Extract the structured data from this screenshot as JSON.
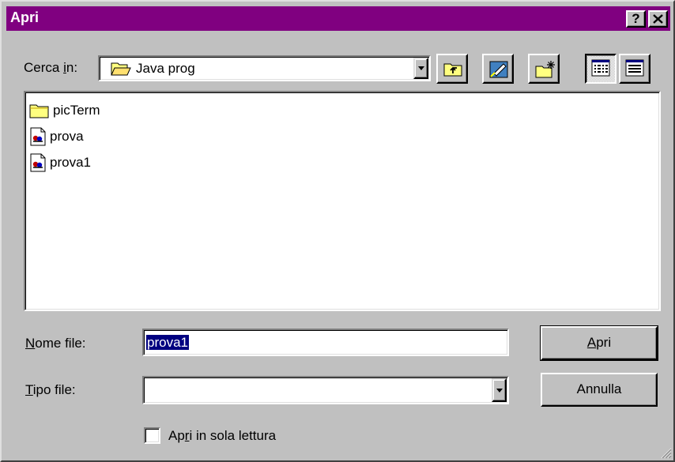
{
  "window": {
    "title": "Apri",
    "help_label": "?"
  },
  "look_in": {
    "label_prefix": "Cerca ",
    "label_hotkey": "i",
    "label_suffix": "n:",
    "value": "Java prog"
  },
  "toolbar": {
    "buttons": [
      {
        "name": "up-one-level",
        "icon": "folder-up-icon"
      },
      {
        "name": "desktop",
        "icon": "desktop-icon"
      },
      {
        "name": "new-folder",
        "icon": "new-folder-icon"
      },
      {
        "name": "list-view",
        "icon": "list-view-icon",
        "pressed": true
      },
      {
        "name": "details-view",
        "icon": "details-view-icon",
        "pressed": false
      }
    ]
  },
  "files": [
    {
      "name": "picTerm",
      "icon": "folder-icon"
    },
    {
      "name": "prova",
      "icon": "java-file-icon"
    },
    {
      "name": "prova1",
      "icon": "java-file-icon"
    }
  ],
  "filename": {
    "label_hotkey": "N",
    "label_rest": "ome file:",
    "value": "prova1"
  },
  "filetype": {
    "label_hotkey": "T",
    "label_rest": "ipo file:",
    "value": ""
  },
  "readonly": {
    "label_prefix": "Ap",
    "label_hotkey": "r",
    "label_suffix": "i in sola lettura",
    "checked": false
  },
  "buttons": {
    "open_hotkey": "A",
    "open_rest": "pri",
    "cancel": "Annulla"
  },
  "colors": {
    "titlebar": "#800080",
    "selection": "#000080",
    "face": "#c0c0c0"
  }
}
